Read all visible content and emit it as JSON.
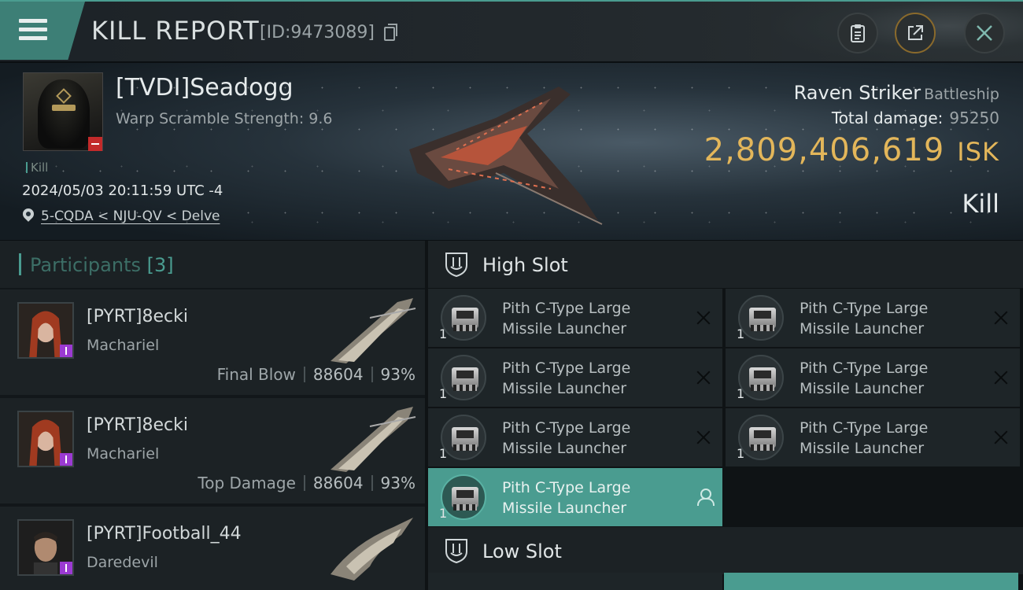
{
  "header": {
    "title": "KILL REPORT",
    "report_id": "[ID:9473089]"
  },
  "victim": {
    "name": "[TVDI]Seadogg",
    "warp_scramble": "Warp Scramble Strength: 9.6",
    "kill_tag": "Kill",
    "datetime": "2024/05/03 20:11:59 UTC -4",
    "location": "5-CQDA < NJU-QV < Delve",
    "ship_name": "Raven Striker",
    "ship_class": "Battleship",
    "total_damage_label": "Total damage:",
    "total_damage": "95250",
    "isk_value": "2,809,406,619",
    "isk_unit": "ISK",
    "result": "Kill"
  },
  "participants": {
    "title": "Participants",
    "count": "[3]",
    "items": [
      {
        "name": "[PYRT]8ecki",
        "ship": "Machariel",
        "role": "Final Blow",
        "damage": "88604",
        "percent": "93%"
      },
      {
        "name": "[PYRT]8ecki",
        "ship": "Machariel",
        "role": "Top Damage",
        "damage": "88604",
        "percent": "93%"
      },
      {
        "name": "[PYRT]Football_44",
        "ship": "Daredevil",
        "role": "",
        "damage": "",
        "percent": ""
      }
    ]
  },
  "slots": {
    "high": {
      "label": "High Slot",
      "modules": [
        {
          "line1": "Pith C-Type Large",
          "line2": "Missile Launcher",
          "qty": "1",
          "state": "destroyed"
        },
        {
          "line1": "Pith C-Type Large",
          "line2": "Missile Launcher",
          "qty": "1",
          "state": "destroyed"
        },
        {
          "line1": "Pith C-Type Large",
          "line2": "Missile Launcher",
          "qty": "1",
          "state": "destroyed"
        },
        {
          "line1": "Pith C-Type Large",
          "line2": "Missile Launcher",
          "qty": "1",
          "state": "destroyed"
        },
        {
          "line1": "Pith C-Type Large",
          "line2": "Missile Launcher",
          "qty": "1",
          "state": "destroyed"
        },
        {
          "line1": "Pith C-Type Large",
          "line2": "Missile Launcher",
          "qty": "1",
          "state": "destroyed"
        },
        {
          "line1": "Pith C-Type Large",
          "line2": "Missile Launcher",
          "qty": "1",
          "state": "dropped"
        }
      ]
    },
    "low": {
      "label": "Low Slot"
    }
  },
  "colors": {
    "accent": "#4a9c90",
    "isk_gold": "#e3b65a",
    "corp_badge": "#9b3ad2",
    "hostile_badge": "#c32a2a"
  },
  "icons": {
    "menu": "hamburger-icon",
    "copy": "copy-icon",
    "clipboard": "clipboard-icon",
    "share": "share-icon",
    "close": "close-icon",
    "location": "location-pin-icon",
    "slot": "shield-icon",
    "destroyed": "x-icon",
    "dropped": "pilot-icon"
  }
}
